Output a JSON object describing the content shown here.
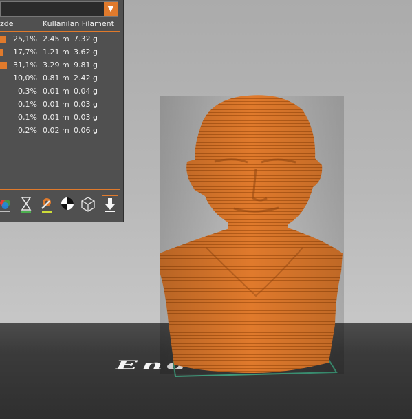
{
  "panel": {
    "header_percent": "zde",
    "header_used": "Kullanılan Filament",
    "dropdown_arrow": "▼",
    "rows": [
      {
        "percent": "25,1%",
        "length": "2.45 m",
        "weight": "7.32 g",
        "bar": 0.251
      },
      {
        "percent": "17,7%",
        "length": "1.21 m",
        "weight": "3.62 g",
        "bar": 0.177
      },
      {
        "percent": "31,1%",
        "length": "3.29 m",
        "weight": "9.81 g",
        "bar": 0.311
      },
      {
        "percent": "10,0%",
        "length": "0.81 m",
        "weight": "2.42 g",
        "bar": 0.0
      },
      {
        "percent": "0,3%",
        "length": "0.01 m",
        "weight": "0.04 g",
        "bar": 0.0
      },
      {
        "percent": "0,1%",
        "length": "0.01 m",
        "weight": "0.03 g",
        "bar": 0.0
      },
      {
        "percent": "0,1%",
        "length": "0.01 m",
        "weight": "0.03 g",
        "bar": 0.0
      },
      {
        "percent": "0,2%",
        "length": "0.02 m",
        "weight": "0.06 g",
        "bar": 0.0
      }
    ],
    "toolbar": [
      "color-print-icon",
      "print-time-icon",
      "tool-settings-icon",
      "balance-icon",
      "wireframe-cube-icon",
      "download-export-icon"
    ]
  },
  "model": {
    "color": "#e07a2c",
    "bed_text": "Ender"
  },
  "accent": "#e07a2c"
}
